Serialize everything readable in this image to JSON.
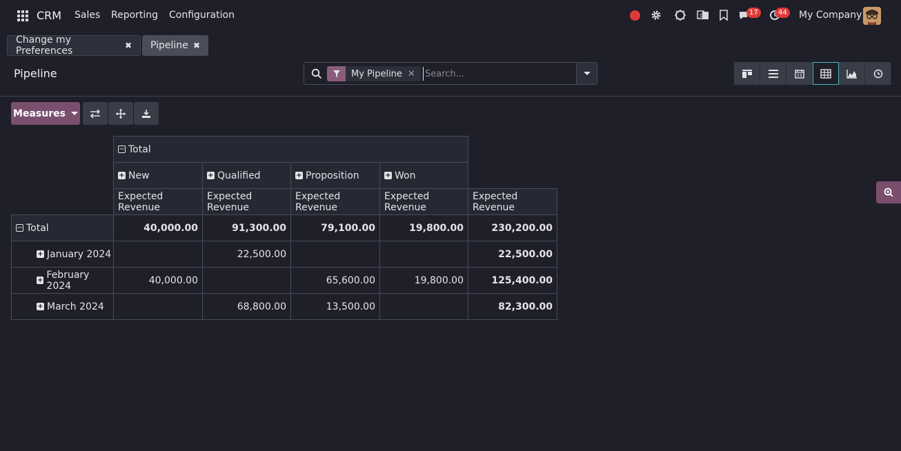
{
  "navbar": {
    "app_name": "CRM",
    "menu": [
      "Sales",
      "Reporting",
      "Configuration"
    ],
    "messages_count": "17",
    "activities_count": "44",
    "company": "My Company"
  },
  "breadcrumbs": [
    {
      "label": "Change my Preferences"
    },
    {
      "label": "Pipeline"
    }
  ],
  "control_panel": {
    "title": "Pipeline",
    "search": {
      "facet_label": "My Pipeline",
      "placeholder": "Search..."
    },
    "views": [
      "kanban",
      "list",
      "calendar",
      "pivot",
      "graph",
      "activity"
    ],
    "active_view": "pivot"
  },
  "toolbar": {
    "measures_label": "Measures"
  },
  "pivot": {
    "col_total_label": "Total",
    "columns": [
      "New",
      "Qualified",
      "Proposition",
      "Won"
    ],
    "measure_label": "Expected Revenue",
    "row_total_label": "Total",
    "rows": [
      {
        "label": "Total",
        "values": [
          "40,000.00",
          "91,300.00",
          "79,100.00",
          "19,800.00",
          "230,200.00"
        ]
      },
      {
        "label": "January 2024",
        "values": [
          "",
          "22,500.00",
          "",
          "",
          "22,500.00"
        ]
      },
      {
        "label": "February 2024",
        "values": [
          "40,000.00",
          "",
          "65,600.00",
          "19,800.00",
          "125,400.00"
        ]
      },
      {
        "label": "March 2024",
        "values": [
          "",
          "68,800.00",
          "13,500.00",
          "",
          "82,300.00"
        ]
      }
    ]
  },
  "colors": {
    "background": "#1e1f29",
    "accent": "#7a4f6e",
    "active_view_border": "#4fb3c2",
    "badge": "#e03a3a"
  }
}
